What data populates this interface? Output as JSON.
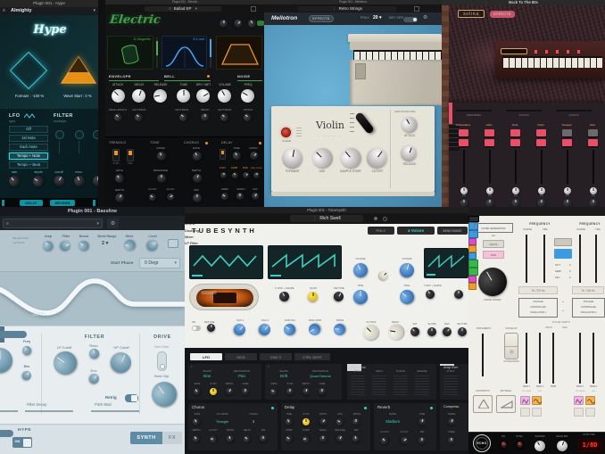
{
  "hype": {
    "window_title": "Plugin 001 - Hype",
    "preset": "Almighty",
    "logo": "Hype",
    "formant": "Formant : -100 %",
    "wave_start": "Wave Start : 0 %",
    "lfo_title": "LFO",
    "lfo_sub": "sync",
    "lfo_options": [
      "Off",
      "1st Note",
      "Each Note",
      "Tempo + Note",
      "Tempo + Beat"
    ],
    "rate": "rate",
    "depth": "depth",
    "filter_title": "FILTER",
    "filter_sub": "envelope",
    "cutoff": "cutoff",
    "reso": "reso",
    "tab_delay": "DELAY",
    "tab_reverb": "REVERB"
  },
  "electric": {
    "window_title": "Plugin 001 - Electric",
    "preset": "Ballad EP",
    "logo": "Electric",
    "pickup_value": "D-Magnetic",
    "bell_value": "5.1 mm",
    "env_title": "ENVELOPE",
    "bell_title": "BELL",
    "noise_title": "NOISE",
    "knobs_main": [
      "ATTACK",
      "DECAY",
      "RELEASE",
      "TUNE",
      "DRY / WET",
      "VOLUME",
      "FREQ"
    ],
    "knobs_sub": [
      "PEAK LENGTH",
      "KEYTRACK",
      "KEYTRACK",
      "DECAY",
      "KEYTRACK",
      "ATTACK"
    ],
    "fx_titles": [
      "TREMOLO",
      "TONE",
      "CHORUS",
      "DELAY"
    ],
    "tremolo": {
      "sw1": "SYNC",
      "sw2": "PAN",
      "k1": "RATE",
      "k2": "DEPTH"
    },
    "tone": {
      "k1": "DRIVE",
      "k2": "MIDRANGE",
      "k3": "LO CUT",
      "k4": "HI CUT"
    },
    "chorus": {
      "k1": "RATE",
      "k2": "DEPTH",
      "k3": "MIX"
    },
    "delay": {
      "k1": "TIME",
      "k2": "RATIO",
      "badges": [
        "SYNC",
        "DAMP",
        "MOD",
        "PING PONG"
      ],
      "k3": "FDBK",
      "k4": "WIDTH",
      "k5": "MIX"
    }
  },
  "mellotron": {
    "window_title": "Plugin 001 - Mellotron",
    "preset": "Retro Strings",
    "logo": "Mellotron",
    "effects": "EFFECTS",
    "poly_label": "POLY",
    "poly_value": "20",
    "keyoff": "KEY OFF",
    "clean": "CLEAN",
    "model": "Violin",
    "knobs": [
      "FORMANT",
      "AGE",
      "SAMPLE START",
      "CUTOFF"
    ],
    "amp_env": "AMP ENVELOPE",
    "attack": "ATTACK",
    "release": "RELEASE"
  },
  "solina": {
    "window_title": "Back To The 80s",
    "logo": "solina",
    "effects": "EFFECTS",
    "sliders": [
      "CRESCENDO",
      "SUSTAIN",
      "CHORUS"
    ],
    "channels": [
      "Contra Bass",
      "Cello",
      "Viola",
      "Violin",
      "Trumpet",
      "Horn"
    ],
    "pan": "Pan"
  },
  "bassline": {
    "window_title": "Plugin 001 - Bassline",
    "header_line1": "SELECTED",
    "header_line2": "LAYERS",
    "knobs": [
      "Amp",
      "Filter",
      "Boost"
    ],
    "bend_label": "Bend Range",
    "bend_value": "2",
    "glide": "Glide",
    "level": "Level",
    "start_phase_label": "Start Phase",
    "start_phase_value": "0 Degr",
    "wave_name": "Sine",
    "freq": "Freq",
    "env": "Env",
    "filter_title": "FILTER",
    "lp": "LP Cutoff",
    "reso": "Reso",
    "hp": "HP Cutoff",
    "drive_title": "DRIVE",
    "over_drive": "Over Drive",
    "hard_clip": "Hard Clip",
    "retrig": "Retrig",
    "filter_decay": "Filter Decay",
    "pitch_mod": "Pitch Mod",
    "hype": "HYPE",
    "on": "ON",
    "synth": "SYNTH",
    "fx": "FX"
  },
  "tubesynth": {
    "window_title": "Plugin 001 - TubeSynth",
    "preset": "Rich Swell",
    "logo": "TUBESYNTH",
    "poly": "POLY",
    "voices": "4 Voices",
    "bend": "BEND RANGE",
    "sub_osc": "Sub Osc",
    "osc1": "Osc 1",
    "osc2": "Osc 2",
    "fenv": "F ENV + SHAPE",
    "quad": "QUAD",
    "detune": "DETUNE",
    "octave": "OCTAVE",
    "fine": "FINE",
    "doubling": "Doubling",
    "on": "ON",
    "doubling_detune": "DETUNE",
    "mixer": "Mixer",
    "mixer_knobs": [
      "OSC 1",
      "OSC 2",
      "SUB OSC",
      "RING MOD",
      "DRIVE"
    ],
    "lp_filter": "LP Filter",
    "filter_knobs": [
      "CUTOFF",
      "RESO",
      "SAT",
      "SLOPE",
      "ENV",
      "KEYTRK"
    ],
    "tabs": [
      "LFO",
      "MOD",
      "ENV 3",
      "CTRL DEST"
    ],
    "shape_label": "SHAPE",
    "dest_label": "DESTINATION",
    "lfo1": {
      "num": "1",
      "shape": "Sine",
      "dest": "Pan"
    },
    "lfo2": {
      "num": "2",
      "shape": "Drift",
      "dest": "Quad Detune"
    },
    "lfo_knobs": [
      "RATE",
      "SYNC",
      "DEPTH",
      "FADE"
    ],
    "chorus": {
      "title": "Chorus",
      "rate": "RATE",
      "wave_label": "LFO WAVE",
      "wave": "Triangle",
      "voices_label": "VOICES",
      "voices": "3",
      "row": [
        "DEPTH",
        "LO CUT",
        "WIDTH",
        "DELAY",
        "MIX"
      ]
    },
    "delay": {
      "title": "Delay",
      "row1": [
        "TIME",
        "SYNC",
        "RATIO",
        "HPF",
        "WIDTH"
      ],
      "row2": [
        "FDBK",
        "DAMP",
        "RESO",
        "RES FRQ",
        "MIX"
      ]
    },
    "filter_env": {
      "title": "Filter Env",
      "sliders": [
        "ATTACK",
        "DECAY",
        "SUSTAIN",
        "RELEASE"
      ]
    },
    "amp_env_title": "Amp Env",
    "amp_env_first": "ATTACK",
    "reverb": {
      "title": "Reverb",
      "mode_label": "MODE",
      "mode": "Stadium",
      "time": "TIME",
      "row": [
        "LO CUT",
        "HI CUT",
        "MIX"
      ]
    },
    "comp": {
      "title": "Compress",
      "k1": "THRES",
      "k2": "KNEE"
    }
  },
  "modular": {
    "noise_title": "NOISE GENERATOR",
    "sh": "S/H",
    "white": "WHITE",
    "pink": "PINK",
    "voice_count": "VOICE COUNT",
    "portamento": "PORTAMENTO",
    "oct_up": "OCTAVE UP",
    "oct_down": "OCTAVE DOWN",
    "footswitch": "FOOTSWITCH",
    "ext_pedal": "EXT PEDAL",
    "frequency": "FREQUENCY",
    "coarse": "COARSE",
    "fine": "FINE",
    "rows": [
      "OCT",
      "SEMI",
      "KEY"
    ],
    "row_values": [
      "0",
      "0",
      "0"
    ],
    "hz1": "76.729 Hz",
    "hz2": "76.748 Hz",
    "vco1": [
      "VOLTAGE",
      "CONTROLLED",
      "OSCILLATOR 1"
    ],
    "vco2": [
      "VOLTAGE",
      "CONTROLLED",
      "OSCILLATOR 2"
    ],
    "pulse_width": "PULSE WIDTH",
    "width": "WIDTH",
    "mod": "MOD",
    "mod1": "MOD 1",
    "mod2": "MOD 2",
    "pwm": "PWM",
    "lfo_rate": "LFO RATE",
    "echo": {
      "logo": "ECHO",
      "on": "ON",
      "sync": "SYNC",
      "sustain": "SUSTAIN",
      "mix": "ECHO MIX",
      "time_label": "ECHO TIME",
      "time": "1/8D"
    }
  }
}
